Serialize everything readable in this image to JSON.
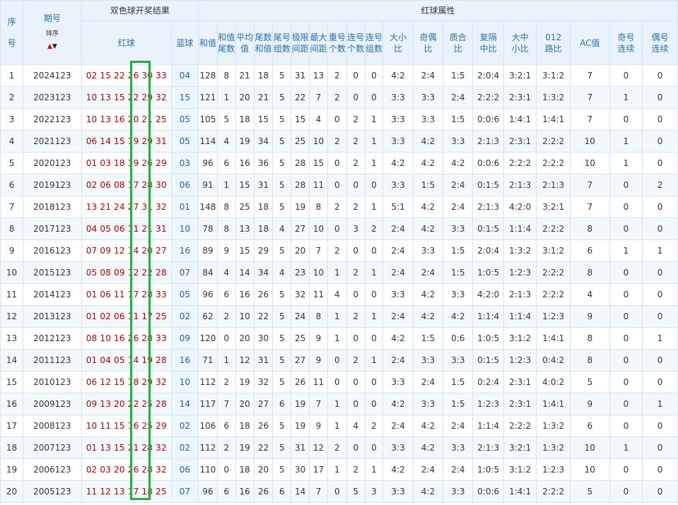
{
  "header": {
    "seq": "序号",
    "period": "期号",
    "sort_label": "排序",
    "draw_result": "双色球开奖结果",
    "red_ball": "红球",
    "blue_ball": "蓝球",
    "red_attr": "红球属性",
    "sum": "和值",
    "attrs": [
      [
        "和值",
        "尾数"
      ],
      [
        "平均",
        "值"
      ],
      [
        "尾数",
        "和值"
      ],
      [
        "尾号",
        "组数"
      ],
      [
        "极限",
        "间距"
      ],
      [
        "最大",
        "间距"
      ],
      [
        "重号",
        "个数"
      ],
      [
        "连号",
        "个数"
      ],
      [
        "连号",
        "组数"
      ],
      [
        "大小",
        "比"
      ],
      [
        "奇偶",
        "比"
      ],
      [
        "质合",
        "比"
      ],
      [
        "复隔",
        "中比"
      ],
      [
        "大中",
        "小比"
      ],
      [
        "012",
        "路比"
      ],
      [
        "AC值",
        ""
      ],
      [
        "奇号",
        "连续"
      ],
      [
        "偶号",
        "连续"
      ]
    ]
  },
  "rows": [
    {
      "seq": "1",
      "period": "2024123",
      "red": "02 15 22 26 30 33",
      "blue": "04",
      "sum": "128",
      "sum_tail": "8",
      "avg": "21",
      "tail_sum": "18",
      "tail_groups": "5",
      "limit_gap": "31",
      "max_gap": "13",
      "repeat": "2",
      "consec_count": "0",
      "consec_groups": "0",
      "big_small": "4:2",
      "odd_even": "2:4",
      "prime": "1:5",
      "rep_gap": "2:0:4",
      "bms": "3:2:1",
      "route": "3:1:2",
      "ac": "7",
      "odd_cont": "0",
      "even_cont": "0"
    },
    {
      "seq": "2",
      "period": "2023123",
      "red": "10 13 15 22 29 32",
      "blue": "15",
      "sum": "121",
      "sum_tail": "1",
      "avg": "20",
      "tail_sum": "21",
      "tail_groups": "5",
      "limit_gap": "22",
      "max_gap": "7",
      "repeat": "2",
      "consec_count": "0",
      "consec_groups": "0",
      "big_small": "3:3",
      "odd_even": "3:3",
      "prime": "2:4",
      "rep_gap": "2:2:2",
      "bms": "2:3:1",
      "route": "1:3:2",
      "ac": "7",
      "odd_cont": "1",
      "even_cont": "0"
    },
    {
      "seq": "3",
      "period": "2022123",
      "red": "10 13 16 20 21 25",
      "blue": "05",
      "sum": "105",
      "sum_tail": "5",
      "avg": "18",
      "tail_sum": "15",
      "tail_groups": "5",
      "limit_gap": "15",
      "max_gap": "4",
      "repeat": "0",
      "consec_count": "2",
      "consec_groups": "1",
      "big_small": "3:3",
      "odd_even": "3:3",
      "prime": "1:5",
      "rep_gap": "0:0:6",
      "bms": "1:4:1",
      "route": "1:4:1",
      "ac": "7",
      "odd_cont": "0",
      "even_cont": "0"
    },
    {
      "seq": "4",
      "period": "2021123",
      "red": "06 14 15 19 29 31",
      "blue": "05",
      "sum": "114",
      "sum_tail": "4",
      "avg": "19",
      "tail_sum": "34",
      "tail_groups": "5",
      "limit_gap": "25",
      "max_gap": "10",
      "repeat": "2",
      "consec_count": "2",
      "consec_groups": "1",
      "big_small": "3:3",
      "odd_even": "4:2",
      "prime": "3:3",
      "rep_gap": "2:1:3",
      "bms": "2:3:1",
      "route": "2:2:2",
      "ac": "10",
      "odd_cont": "1",
      "even_cont": "0"
    },
    {
      "seq": "5",
      "period": "2020123",
      "red": "01 03 18 19 26 29",
      "blue": "03",
      "sum": "96",
      "sum_tail": "6",
      "avg": "16",
      "tail_sum": "36",
      "tail_groups": "5",
      "limit_gap": "28",
      "max_gap": "15",
      "repeat": "0",
      "consec_count": "2",
      "consec_groups": "1",
      "big_small": "4:2",
      "odd_even": "4:2",
      "prime": "4:2",
      "rep_gap": "0:0:6",
      "bms": "2:2:2",
      "route": "2:2:2",
      "ac": "10",
      "odd_cont": "1",
      "even_cont": "0"
    },
    {
      "seq": "6",
      "period": "2019123",
      "red": "02 06 08 17 28 30",
      "blue": "06",
      "sum": "91",
      "sum_tail": "1",
      "avg": "15",
      "tail_sum": "31",
      "tail_groups": "5",
      "limit_gap": "28",
      "max_gap": "11",
      "repeat": "0",
      "consec_count": "0",
      "consec_groups": "0",
      "big_small": "3:3",
      "odd_even": "1:5",
      "prime": "2:4",
      "rep_gap": "0:1:5",
      "bms": "2:1:3",
      "route": "2:1:3",
      "ac": "7",
      "odd_cont": "0",
      "even_cont": "2"
    },
    {
      "seq": "7",
      "period": "2018123",
      "red": "13 21 24 27 31 32",
      "blue": "01",
      "sum": "148",
      "sum_tail": "8",
      "avg": "25",
      "tail_sum": "18",
      "tail_groups": "5",
      "limit_gap": "19",
      "max_gap": "8",
      "repeat": "2",
      "consec_count": "2",
      "consec_groups": "1",
      "big_small": "5:1",
      "odd_even": "4:2",
      "prime": "2:4",
      "rep_gap": "2:1:3",
      "bms": "4:2:0",
      "route": "3:2:1",
      "ac": "7",
      "odd_cont": "0",
      "even_cont": "0"
    },
    {
      "seq": "8",
      "period": "2017123",
      "red": "04 05 06 11 21 31",
      "blue": "10",
      "sum": "78",
      "sum_tail": "8",
      "avg": "13",
      "tail_sum": "18",
      "tail_groups": "4",
      "limit_gap": "27",
      "max_gap": "10",
      "repeat": "0",
      "consec_count": "3",
      "consec_groups": "2",
      "big_small": "2:4",
      "odd_even": "4:2",
      "prime": "3:3",
      "rep_gap": "0:1:5",
      "bms": "1:1:4",
      "route": "2:2:2",
      "ac": "8",
      "odd_cont": "0",
      "even_cont": "0"
    },
    {
      "seq": "9",
      "period": "2016123",
      "red": "07 09 12 14 20 27",
      "blue": "16",
      "sum": "89",
      "sum_tail": "9",
      "avg": "15",
      "tail_sum": "29",
      "tail_groups": "5",
      "limit_gap": "20",
      "max_gap": "7",
      "repeat": "2",
      "consec_count": "0",
      "consec_groups": "0",
      "big_small": "2:4",
      "odd_even": "3:3",
      "prime": "1:5",
      "rep_gap": "2:0:4",
      "bms": "1:3:2",
      "route": "3:1:2",
      "ac": "6",
      "odd_cont": "1",
      "even_cont": "1"
    },
    {
      "seq": "10",
      "period": "2015123",
      "red": "05 08 09 12 22 28",
      "blue": "07",
      "sum": "84",
      "sum_tail": "4",
      "avg": "14",
      "tail_sum": "34",
      "tail_groups": "4",
      "limit_gap": "23",
      "max_gap": "10",
      "repeat": "1",
      "consec_count": "2",
      "consec_groups": "1",
      "big_small": "2:4",
      "odd_even": "2:4",
      "prime": "1:5",
      "rep_gap": "1:0:5",
      "bms": "1:2:3",
      "route": "2:2:2",
      "ac": "8",
      "odd_cont": "0",
      "even_cont": "0"
    },
    {
      "seq": "11",
      "period": "2014123",
      "red": "01 06 11 17 28 33",
      "blue": "05",
      "sum": "96",
      "sum_tail": "6",
      "avg": "16",
      "tail_sum": "26",
      "tail_groups": "5",
      "limit_gap": "32",
      "max_gap": "11",
      "repeat": "4",
      "consec_count": "0",
      "consec_groups": "0",
      "big_small": "3:3",
      "odd_even": "4:2",
      "prime": "3:3",
      "rep_gap": "4:2:0",
      "bms": "2:1:3",
      "route": "2:2:2",
      "ac": "4",
      "odd_cont": "0",
      "even_cont": "0"
    },
    {
      "seq": "12",
      "period": "2013123",
      "red": "01 02 06 11 17 25",
      "blue": "02",
      "sum": "62",
      "sum_tail": "2",
      "avg": "10",
      "tail_sum": "22",
      "tail_groups": "5",
      "limit_gap": "24",
      "max_gap": "8",
      "repeat": "1",
      "consec_count": "2",
      "consec_groups": "1",
      "big_small": "2:4",
      "odd_even": "4:2",
      "prime": "4:2",
      "rep_gap": "1:1:4",
      "bms": "1:1:4",
      "route": "1:2:3",
      "ac": "9",
      "odd_cont": "0",
      "even_cont": "0"
    },
    {
      "seq": "13",
      "period": "2012123",
      "red": "08 10 16 26 28 33",
      "blue": "09",
      "sum": "120",
      "sum_tail": "0",
      "avg": "20",
      "tail_sum": "30",
      "tail_groups": "5",
      "limit_gap": "25",
      "max_gap": "9",
      "repeat": "1",
      "consec_count": "0",
      "consec_groups": "0",
      "big_small": "4:2",
      "odd_even": "1:5",
      "prime": "0:6",
      "rep_gap": "1:0:5",
      "bms": "3:1:2",
      "route": "1:4:1",
      "ac": "8",
      "odd_cont": "0",
      "even_cont": "1"
    },
    {
      "seq": "14",
      "period": "2011123",
      "red": "01 04 05 14 19 28",
      "blue": "16",
      "sum": "71",
      "sum_tail": "1",
      "avg": "12",
      "tail_sum": "31",
      "tail_groups": "5",
      "limit_gap": "27",
      "max_gap": "9",
      "repeat": "0",
      "consec_count": "2",
      "consec_groups": "1",
      "big_small": "2:4",
      "odd_even": "3:3",
      "prime": "3:3",
      "rep_gap": "0:1:5",
      "bms": "1:2:3",
      "route": "0:4:2",
      "ac": "8",
      "odd_cont": "0",
      "even_cont": "0"
    },
    {
      "seq": "15",
      "period": "2010123",
      "red": "06 12 15 18 29 32",
      "blue": "10",
      "sum": "112",
      "sum_tail": "2",
      "avg": "19",
      "tail_sum": "32",
      "tail_groups": "5",
      "limit_gap": "26",
      "max_gap": "11",
      "repeat": "0",
      "consec_count": "0",
      "consec_groups": "0",
      "big_small": "3:3",
      "odd_even": "2:4",
      "prime": "1:5",
      "rep_gap": "0:2:4",
      "bms": "2:3:1",
      "route": "4:0:2",
      "ac": "5",
      "odd_cont": "0",
      "even_cont": "0"
    },
    {
      "seq": "16",
      "period": "2009123",
      "red": "09 13 20 22 25 28",
      "blue": "14",
      "sum": "117",
      "sum_tail": "7",
      "avg": "20",
      "tail_sum": "27",
      "tail_groups": "6",
      "limit_gap": "19",
      "max_gap": "7",
      "repeat": "1",
      "consec_count": "0",
      "consec_groups": "0",
      "big_small": "4:2",
      "odd_even": "3:3",
      "prime": "1:5",
      "rep_gap": "1:2:3",
      "bms": "2:3:1",
      "route": "1:4:1",
      "ac": "9",
      "odd_cont": "0",
      "even_cont": "1"
    },
    {
      "seq": "17",
      "period": "2008123",
      "red": "10 11 15 16 25 29",
      "blue": "02",
      "sum": "106",
      "sum_tail": "6",
      "avg": "18",
      "tail_sum": "26",
      "tail_groups": "5",
      "limit_gap": "19",
      "max_gap": "9",
      "repeat": "1",
      "consec_count": "4",
      "consec_groups": "2",
      "big_small": "2:4",
      "odd_even": "4:2",
      "prime": "2:4",
      "rep_gap": "1:1:4",
      "bms": "2:2:2",
      "route": "1:3:2",
      "ac": "6",
      "odd_cont": "0",
      "even_cont": "0"
    },
    {
      "seq": "18",
      "period": "2007123",
      "red": "01 13 15 21 28 32",
      "blue": "02",
      "sum": "112",
      "sum_tail": "2",
      "avg": "19",
      "tail_sum": "22",
      "tail_groups": "5",
      "limit_gap": "31",
      "max_gap": "12",
      "repeat": "2",
      "consec_count": "0",
      "consec_groups": "0",
      "big_small": "3:3",
      "odd_even": "4:2",
      "prime": "3:3",
      "rep_gap": "2:1:3",
      "bms": "3:2:1",
      "route": "1:3:2",
      "ac": "10",
      "odd_cont": "1",
      "even_cont": "0"
    },
    {
      "seq": "19",
      "period": "2006123",
      "red": "02 03 20 26 28 32",
      "blue": "06",
      "sum": "110",
      "sum_tail": "0",
      "avg": "18",
      "tail_sum": "20",
      "tail_groups": "5",
      "limit_gap": "30",
      "max_gap": "17",
      "repeat": "1",
      "consec_count": "2",
      "consec_groups": "1",
      "big_small": "4:2",
      "odd_even": "2:4",
      "prime": "2:4",
      "rep_gap": "1:0:5",
      "bms": "3:1:2",
      "route": "1:2:3",
      "ac": "10",
      "odd_cont": "0",
      "even_cont": "0"
    },
    {
      "seq": "20",
      "period": "2005123",
      "red": "11 12 13 17 18 25",
      "blue": "07",
      "sum": "96",
      "sum_tail": "6",
      "avg": "16",
      "tail_sum": "26",
      "tail_groups": "6",
      "limit_gap": "14",
      "max_gap": "7",
      "repeat": "0",
      "consec_count": "5",
      "consec_groups": "3",
      "big_small": "3:3",
      "odd_even": "4:2",
      "prime": "3:3",
      "rep_gap": "0:0:6",
      "bms": "1:4:1",
      "route": "2:2:2",
      "ac": "5",
      "odd_cont": "0",
      "even_cont": "0"
    }
  ],
  "colors": {
    "header_bg": "#eaf3fb",
    "header_text": "#2a6fb0",
    "red_ball": "#b00000",
    "blue_ball": "#1a5fc1",
    "highlight_box": "#2ea84a"
  }
}
